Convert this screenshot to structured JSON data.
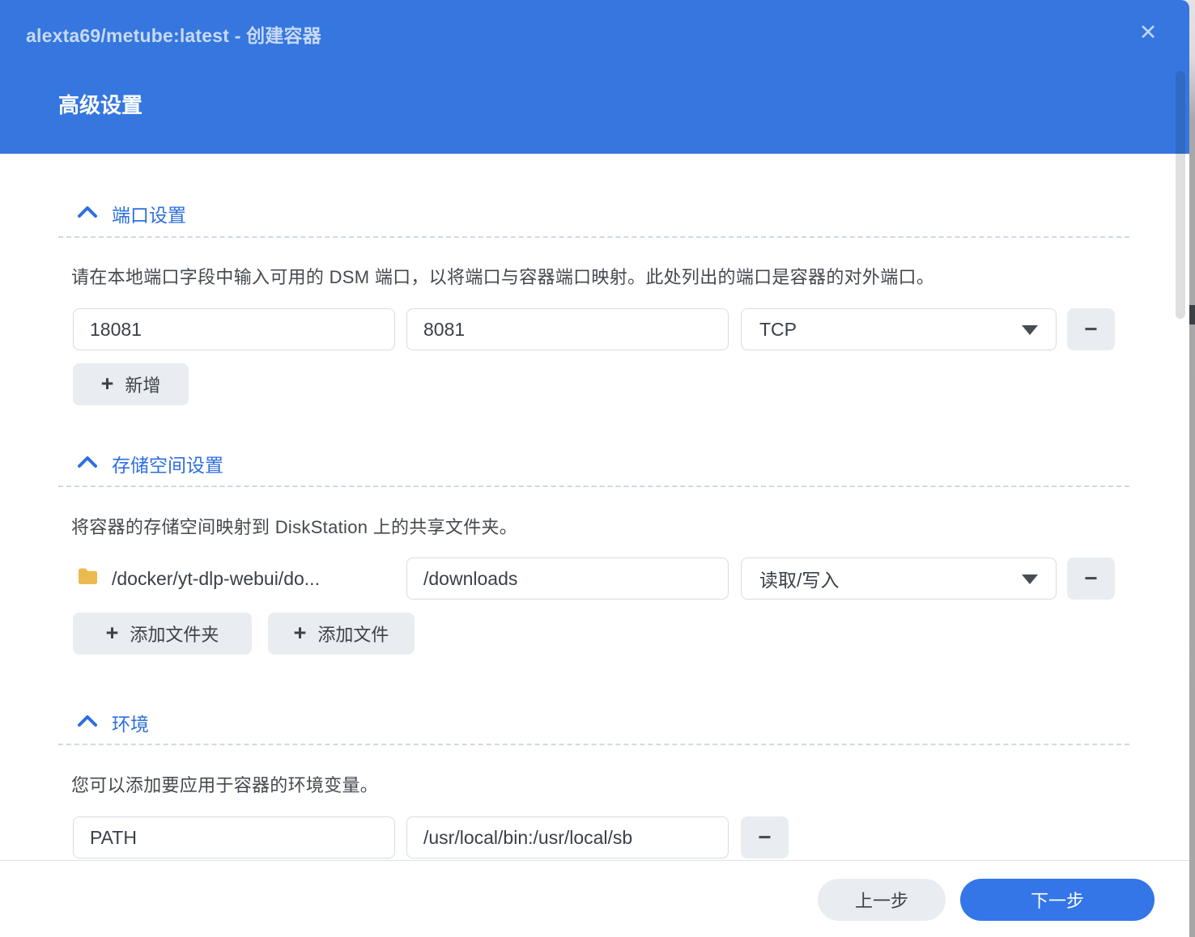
{
  "dialog": {
    "title": "alexta69/metube:latest - 创建容器",
    "heading": "高级设置"
  },
  "icons": {
    "close": "✕",
    "plus": "+",
    "minus": "−"
  },
  "sections": {
    "ports": {
      "title": "端口设置",
      "description": "请在本地端口字段中输入可用的 DSM 端口，以将端口与容器端口映射。此处列出的端口是容器的对外端口。",
      "rows": [
        {
          "local_port": "18081",
          "container_port": "8081",
          "protocol": "TCP"
        }
      ],
      "add_label": "新增"
    },
    "storage": {
      "title": "存储空间设置",
      "description": "将容器的存储空间映射到 DiskStation 上的共享文件夹。",
      "rows": [
        {
          "folder_path": "/docker/yt-dlp-webui/do...",
          "mount_path": "/downloads",
          "permission": "读取/写入"
        }
      ],
      "add_folder_label": "添加文件夹",
      "add_file_label": "添加文件"
    },
    "environment": {
      "title": "环境",
      "description": "您可以添加要应用于容器的环境变量。",
      "rows": [
        {
          "variable": "PATH",
          "value": "/usr/local/bin:/usr/local/sb"
        }
      ]
    }
  },
  "footer": {
    "prev_label": "上一步",
    "next_label": "下一步"
  },
  "colors": {
    "header_bg": "#3577de",
    "accent_blue": "#2d6fe0",
    "next_button": "#3476e8",
    "folder_icon": "#ecb94f"
  }
}
